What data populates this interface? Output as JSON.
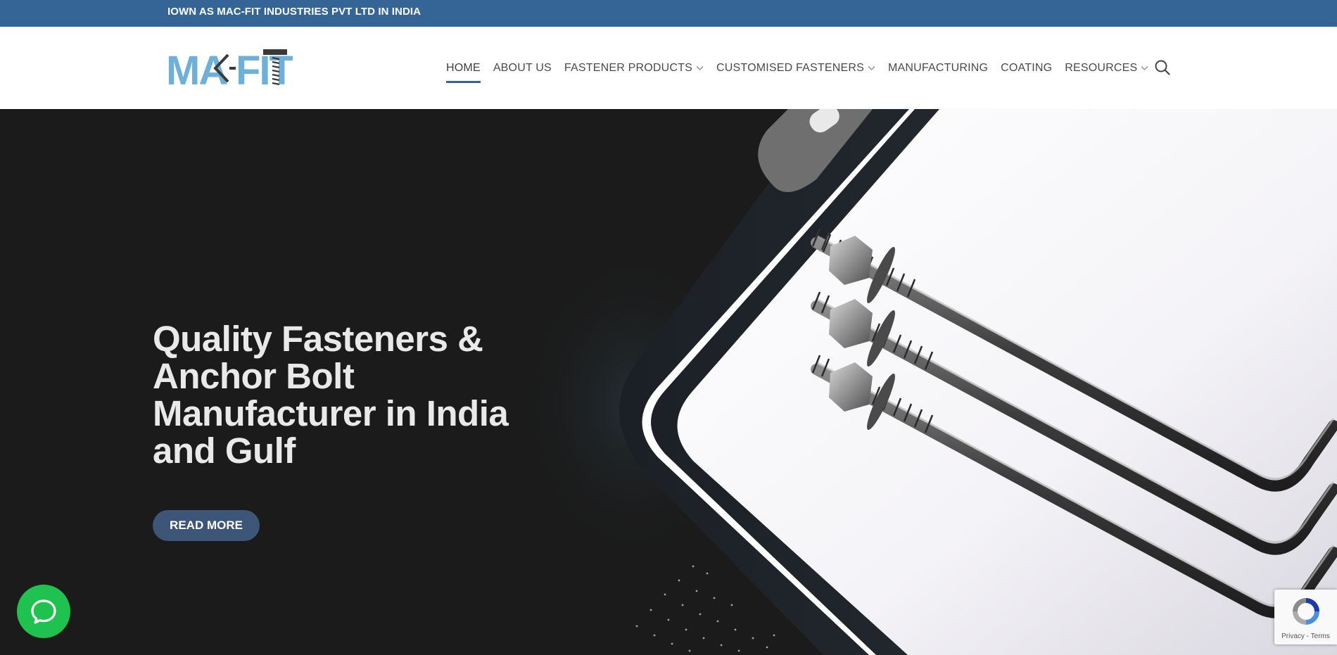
{
  "topbar": {
    "marquee_text": "IOWN AS MAC-FIT INDUSTRIES PVT LTD IN INDIA",
    "bg_color": "#356596"
  },
  "header": {
    "logo": {
      "text_left": "MA",
      "text_right": "FIT",
      "icon": "bolt-logo-icon"
    },
    "nav": [
      {
        "label": "HOME",
        "active": true,
        "dropdown": false
      },
      {
        "label": "ABOUT US",
        "active": false,
        "dropdown": false
      },
      {
        "label": "FASTENER PRODUCTS",
        "active": false,
        "dropdown": true
      },
      {
        "label": "CUSTOMISED FASTENERS",
        "active": false,
        "dropdown": true
      },
      {
        "label": "MANUFACTURING",
        "active": false,
        "dropdown": false
      },
      {
        "label": "COATING",
        "active": false,
        "dropdown": false
      },
      {
        "label": "RESOURCES",
        "active": false,
        "dropdown": true
      }
    ],
    "search_icon": "search-icon",
    "accent_color": "#356596"
  },
  "hero": {
    "title": "Quality Fasteners & Anchor Bolt Manufacturer in India and Gulf",
    "button_label": "READ MORE",
    "image_description_icon": "anchor-bolts-image",
    "bg_color": "#1b1b1b",
    "button_color": "#3d5577"
  },
  "chat": {
    "icon": "chat-bubble-icon",
    "color": "#1fc24f"
  },
  "recaptcha": {
    "privacy": "Privacy",
    "separator": " - ",
    "terms": "Terms",
    "icon": "recaptcha-icon"
  }
}
